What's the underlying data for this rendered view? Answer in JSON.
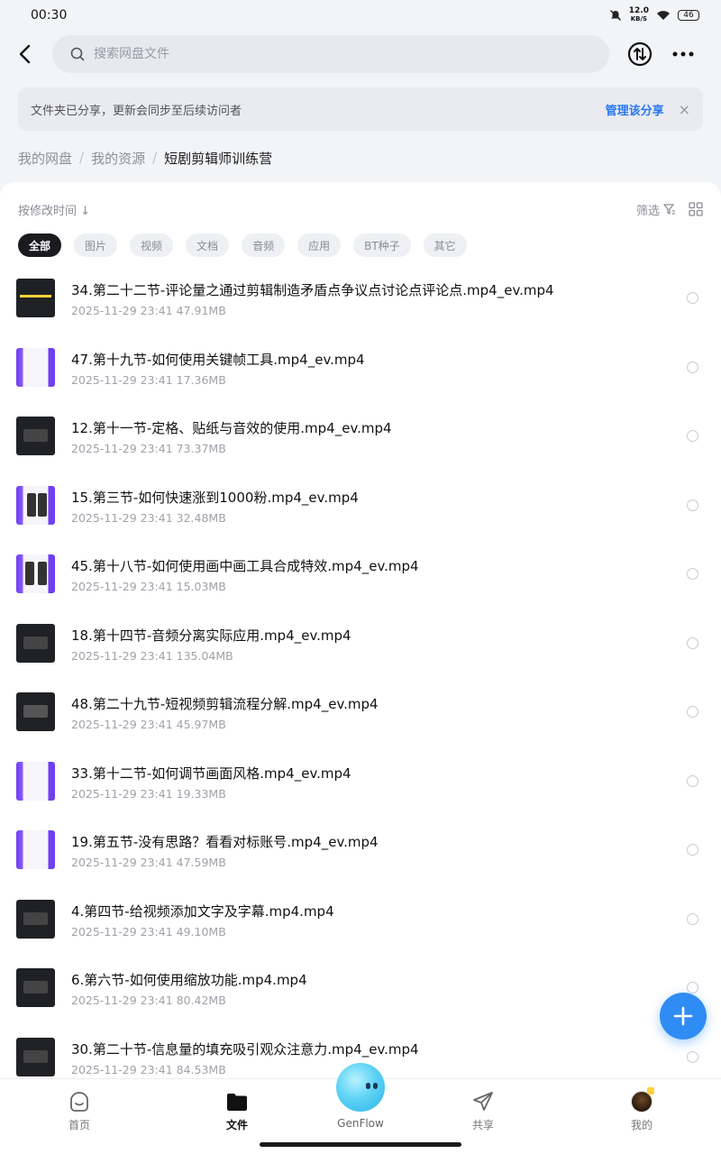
{
  "status_bar": {
    "time": "00:30",
    "net_speed": "12.0",
    "net_unit": "KB/S",
    "battery": "46"
  },
  "header": {
    "search_placeholder": "搜索网盘文件"
  },
  "banner": {
    "text": "文件夹已分享，更新会同步至后续访问者",
    "action": "管理该分享",
    "close": "×"
  },
  "breadcrumb": [
    "我的网盘",
    "我的资源",
    "短剧剪辑师训练营"
  ],
  "toolbar": {
    "sort_label": "按修改时间 ↓",
    "filter_label": "筛选"
  },
  "filter_chips": [
    "全部",
    "图片",
    "视频",
    "文档",
    "音频",
    "应用",
    "BT种子",
    "其它"
  ],
  "files": [
    {
      "name": "34.第二十二节-评论量之通过剪辑制造矛盾点争议点讨论点评论点.mp4_ev.mp4",
      "date": "2025-11-29  23:41",
      "size": "47.91MB",
      "thumb": "dark-yellow"
    },
    {
      "name": "47.第十九节-如何使用关键帧工具.mp4_ev.mp4",
      "date": "2025-11-29  23:41",
      "size": "17.36MB",
      "thumb": "purple"
    },
    {
      "name": "12.第十一节-定格、贴纸与音效的使用.mp4_ev.mp4",
      "date": "2025-11-29  23:41",
      "size": "73.37MB",
      "thumb": "dark"
    },
    {
      "name": "15.第三节-如何快速涨到1000粉.mp4_ev.mp4",
      "date": "2025-11-29  23:41",
      "size": "32.48MB",
      "thumb": "purple-phones"
    },
    {
      "name": "45.第十八节-如何使用画中画工具合成特效.mp4_ev.mp4",
      "date": "2025-11-29  23:41",
      "size": "15.03MB",
      "thumb": "purple-phones"
    },
    {
      "name": "18.第十四节-音频分离实际应用.mp4_ev.mp4",
      "date": "2025-11-29  23:41",
      "size": "135.04MB",
      "thumb": "dark"
    },
    {
      "name": "48.第二十九节-短视频剪辑流程分解.mp4_ev.mp4",
      "date": "2025-11-29  23:41",
      "size": "45.97MB",
      "thumb": "dark"
    },
    {
      "name": "33.第十二节-如何调节画面风格.mp4_ev.mp4",
      "date": "2025-11-29  23:41",
      "size": "19.33MB",
      "thumb": "purple"
    },
    {
      "name": "19.第五节-没有思路？看看对标账号.mp4_ev.mp4",
      "date": "2025-11-29  23:41",
      "size": "47.59MB",
      "thumb": "purple"
    },
    {
      "name": "4.第四节-给视频添加文字及字幕.mp4.mp4",
      "date": "2025-11-29  23:41",
      "size": "49.10MB",
      "thumb": "dark"
    },
    {
      "name": "6.第六节-如何使用缩放功能.mp4.mp4",
      "date": "2025-11-29  23:41",
      "size": "80.42MB",
      "thumb": "dark"
    },
    {
      "name": "30.第二十节-信息量的填充吸引观众注意力.mp4_ev.mp4",
      "date": "2025-11-29  23:41",
      "size": "84.53MB",
      "thumb": "dark"
    }
  ],
  "tabbar": {
    "home": "首页",
    "files": "文件",
    "genflow": "GenFlow",
    "share": "共享",
    "mine": "我的"
  },
  "colors": {
    "accent": "#2a78f0",
    "fab": "#2f8cf4",
    "chip_active": "#1a1a1f"
  }
}
